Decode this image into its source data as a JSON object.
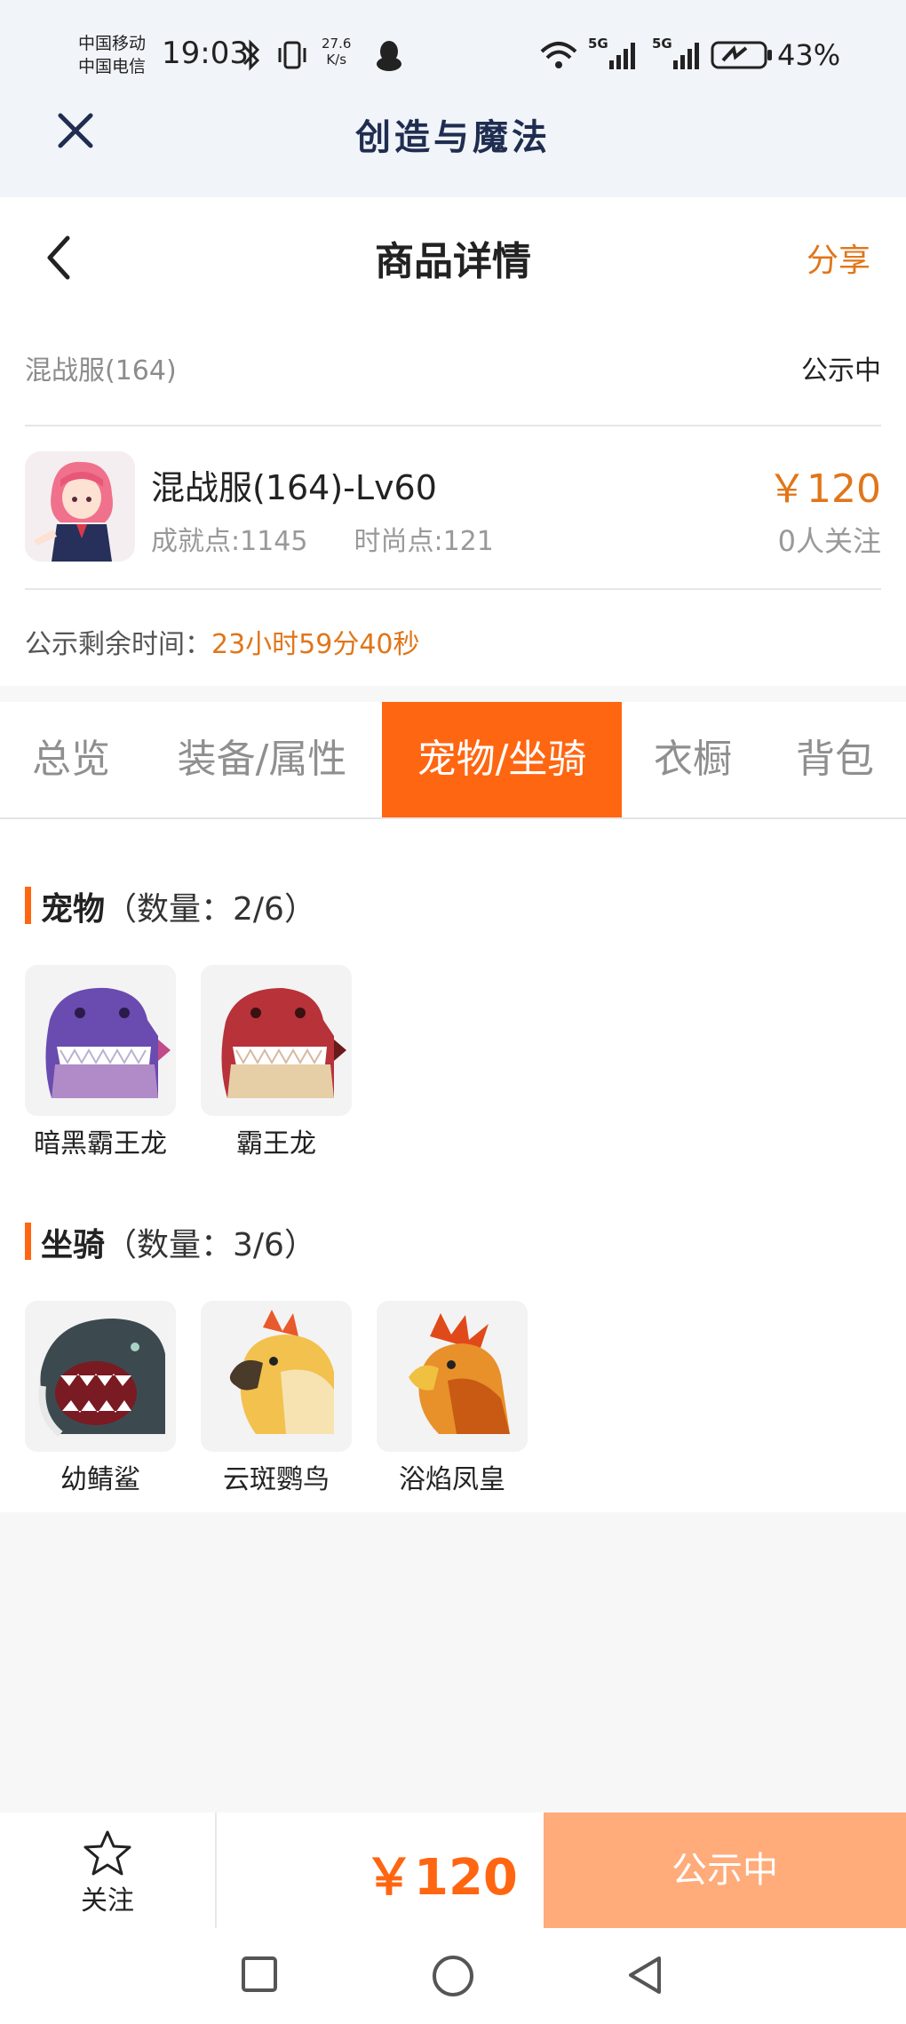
{
  "status_bar": {
    "carrier_1": "中国移动",
    "carrier_2": "中国电信",
    "time": "19:03",
    "net_speed_value": "27.6",
    "net_speed_unit": "K/s",
    "net_5g_1": "5G",
    "net_5g_2": "5G",
    "battery": "43%"
  },
  "app": {
    "title": "创造与魔法"
  },
  "nav": {
    "title": "商品详情",
    "share": "分享"
  },
  "listing": {
    "server": "混战服(164)",
    "status": "公示中",
    "role_name": "混战服(164)-Lv60",
    "achievement": "成就点:1145",
    "fashion": "时尚点:121",
    "price": "￥120",
    "followers": "0人关注",
    "remain_label": "公示剩余时间：",
    "remain_value": "23小时59分40秒"
  },
  "tabs": [
    {
      "label": "总览"
    },
    {
      "label": "装备/属性"
    },
    {
      "label": "宠物/坐骑",
      "active": true
    },
    {
      "label": "衣橱"
    },
    {
      "label": "背包"
    }
  ],
  "pets": {
    "title": "宠物",
    "count": "（数量：2/6）",
    "items": [
      {
        "name": "暗黑霸王龙",
        "icon": "dark-trex-icon"
      },
      {
        "name": "霸王龙",
        "icon": "trex-icon"
      }
    ]
  },
  "mounts": {
    "title": "坐骑",
    "count": "（数量：3/6）",
    "items": [
      {
        "name": "幼鲭鲨",
        "icon": "shark-icon"
      },
      {
        "name": "云斑鹦鸟",
        "icon": "parrot-icon"
      },
      {
        "name": "浴焰凤皇",
        "icon": "phoenix-icon"
      }
    ]
  },
  "bottom_bar": {
    "follow": "关注",
    "price": "￥120",
    "status": "公示中"
  },
  "colors": {
    "accent": "#ff6611",
    "price": "#e0761a",
    "status_button": "#ffab7a",
    "app_title": "#1f2d50"
  }
}
